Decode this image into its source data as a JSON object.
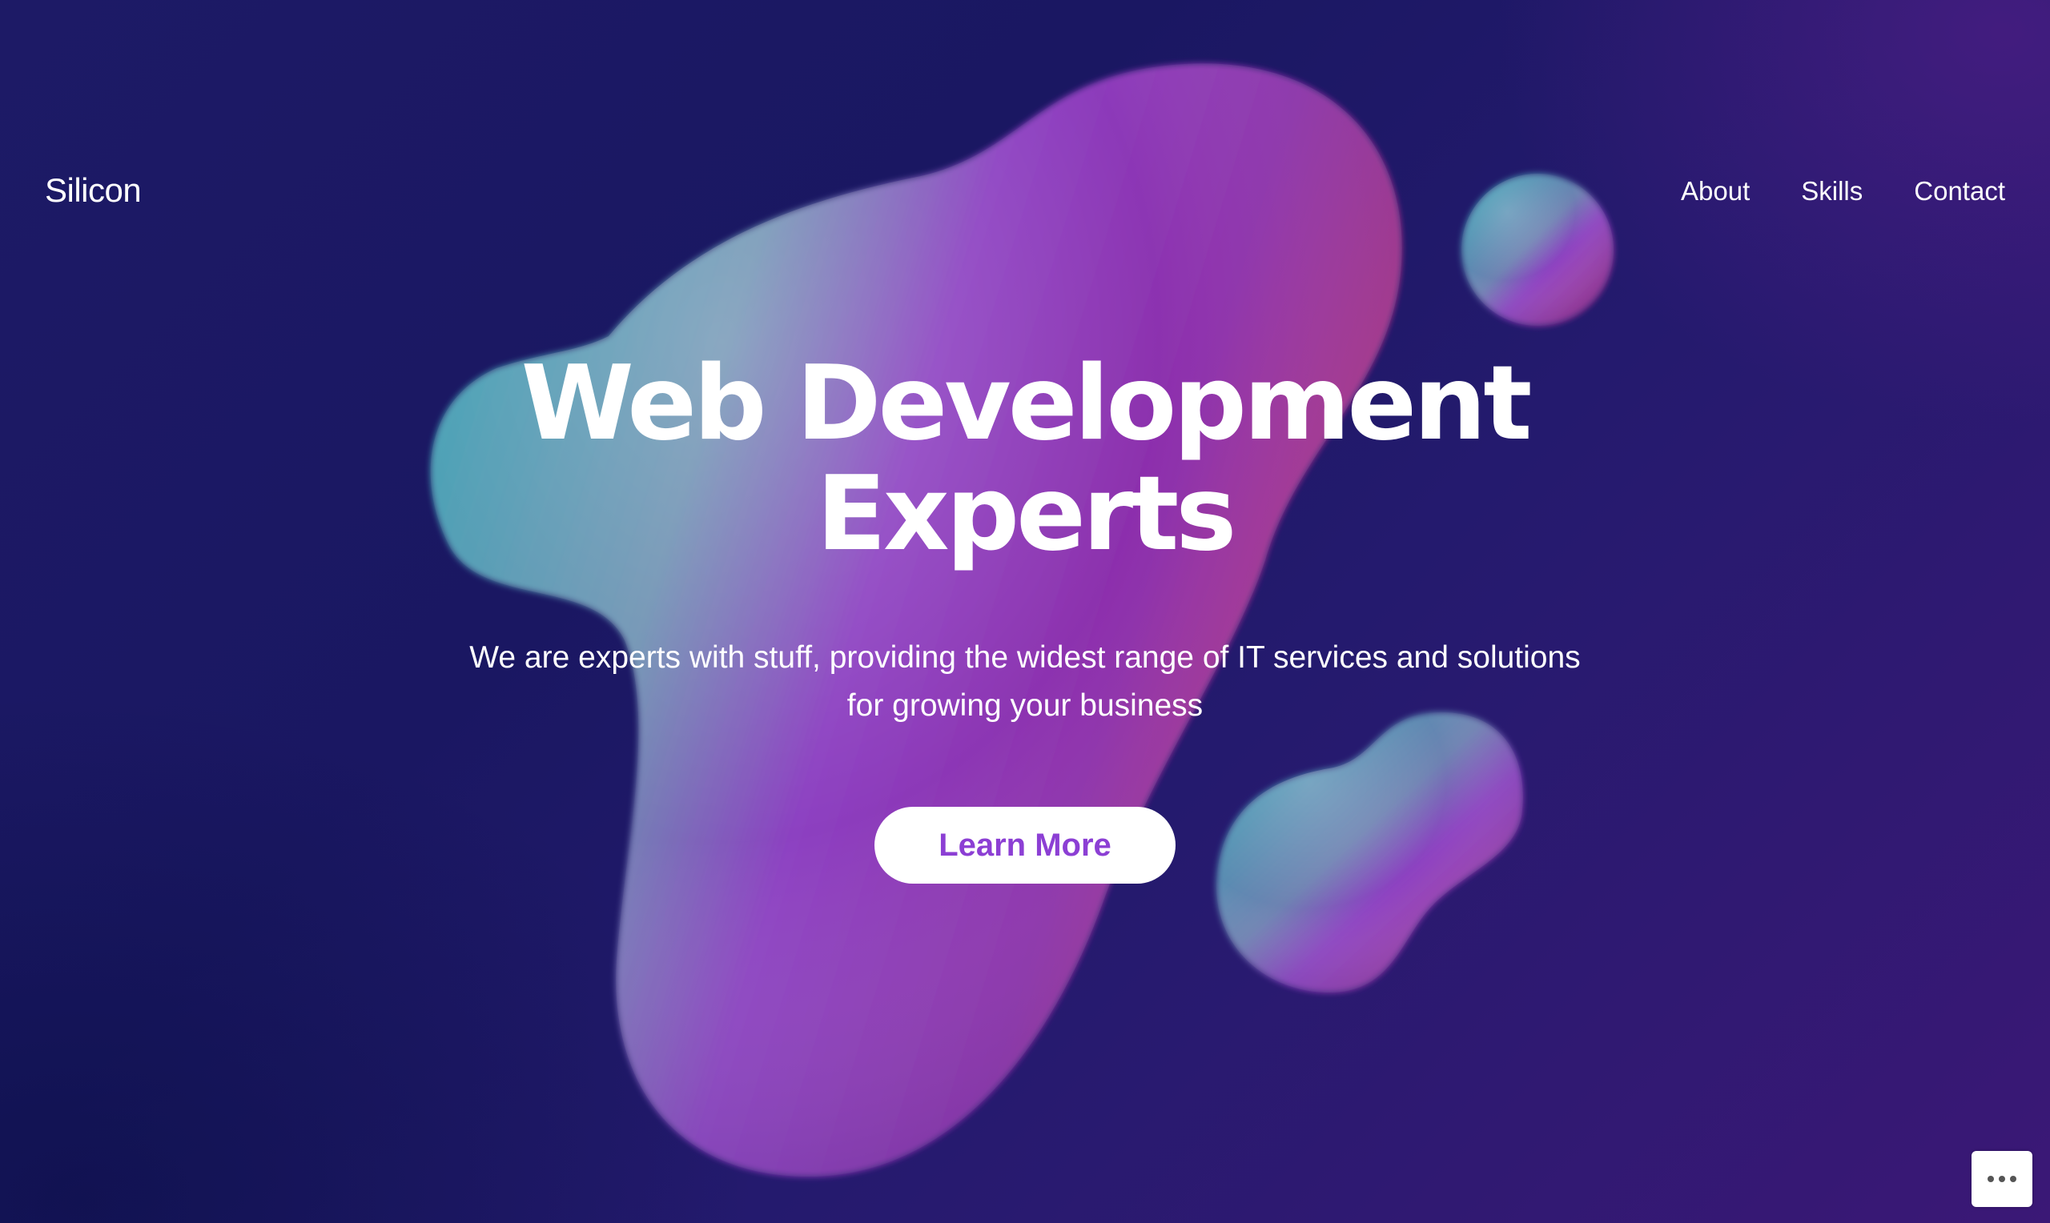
{
  "header": {
    "logo": "Silicon",
    "nav": [
      "About",
      "Skills",
      "Contact"
    ]
  },
  "hero": {
    "title_line1": "Web Development",
    "title_line2": "Experts",
    "subtitle_line1": "We are experts with stuff, providing the widest range of IT services and solutions",
    "subtitle_line2": "for growing your business",
    "cta_label": "Learn More"
  },
  "colors": {
    "background": "#1b1764",
    "accent": "#8c3fd4",
    "text": "#ffffff"
  },
  "icons": {
    "more": "more-horizontal-icon"
  }
}
